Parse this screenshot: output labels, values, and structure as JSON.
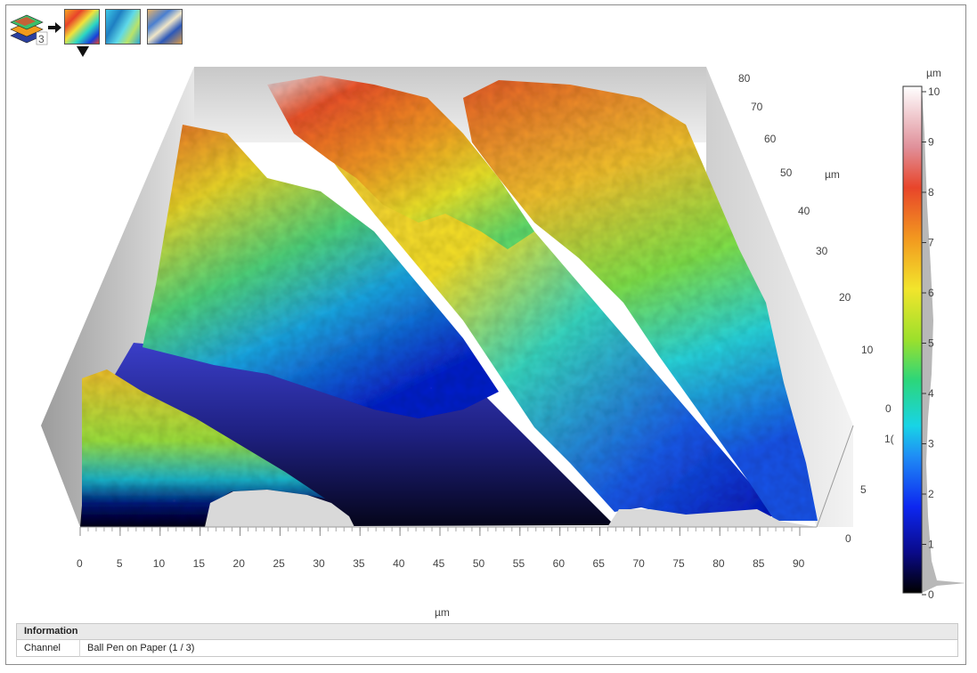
{
  "toolbar": {
    "layer_count": "3",
    "layers_icon": "layers-stack-icon",
    "arrow_icon": "arrow-right-icon",
    "thumbnails": [
      "thumbnail-height-map",
      "thumbnail-texture-cyan",
      "thumbnail-texture-mixed"
    ]
  },
  "view3d": {
    "x_ticks": [
      "0",
      "5",
      "10",
      "15",
      "20",
      "25",
      "30",
      "35",
      "40",
      "45",
      "50",
      "55",
      "60",
      "65",
      "70",
      "75",
      "80",
      "85",
      "90"
    ],
    "x_unit": "µm",
    "y_ticks": [
      "0",
      "5",
      "1(",
      "0",
      "10",
      "20",
      "30",
      "40",
      "50",
      "60",
      "70",
      "80"
    ],
    "y_unit": "µm"
  },
  "colorbar": {
    "unit": "µm",
    "ticks": [
      "0",
      "1",
      "2",
      "3",
      "4",
      "5",
      "6",
      "7",
      "8",
      "9",
      "10"
    ],
    "max": 10
  },
  "info": {
    "header": "Information",
    "rows": [
      {
        "key": "Channel",
        "value": "Ball Pen on Paper (1 / 3)"
      }
    ]
  }
}
